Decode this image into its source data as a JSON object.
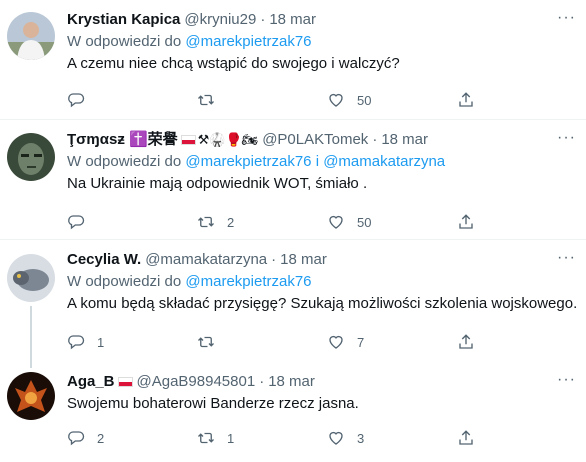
{
  "replying_label": "W odpowiedzi do",
  "replying_joiner": "i",
  "icons": {
    "reply": "reply-icon",
    "retweet": "retweet-icon",
    "like": "heart-icon",
    "share": "share-icon",
    "more": "more-icon"
  },
  "tweets": [
    {
      "name": "Krystian Kapica",
      "handle": "@kryniu29",
      "time": "18 mar",
      "mentions": [
        "@marekpietrzak76"
      ],
      "text": "A czemu niee chcą wstąpić do swojego i walczyć?",
      "replies": "",
      "retweets": "",
      "likes": "50"
    },
    {
      "name": "Ţσɱαѕƶ ✝️荣譽",
      "name_emoji": "⚒🥋🥊🏍",
      "handle": "@P0LAKTomek",
      "time": "18 mar",
      "mentions": [
        "@marekpietrzak76",
        "@mamakatarzyna"
      ],
      "text": "Na Ukrainie mają odpowiednik WOT, śmiało .",
      "replies": "",
      "retweets": "2",
      "likes": "50"
    },
    {
      "name": "Cecylia W.",
      "handle": "@mamakatarzyna",
      "time": "18 mar",
      "mentions": [
        "@marekpietrzak76"
      ],
      "text": "A komu będą składać przysięgę? Szukają możliwości szkolenia wojskowego.",
      "replies": "1",
      "retweets": "",
      "likes": "7"
    },
    {
      "name": "Aga_B",
      "handle": "@AgaB98945801",
      "time": "18 mar",
      "mentions": [],
      "text": "Swojemu bohaterowi Banderze rzecz jasna.",
      "replies": "2",
      "retweets": "1",
      "likes": "3"
    }
  ],
  "colors": {
    "accent": "#1d9bf0",
    "secondary_text": "#536471",
    "divider": "#eff3f4"
  }
}
